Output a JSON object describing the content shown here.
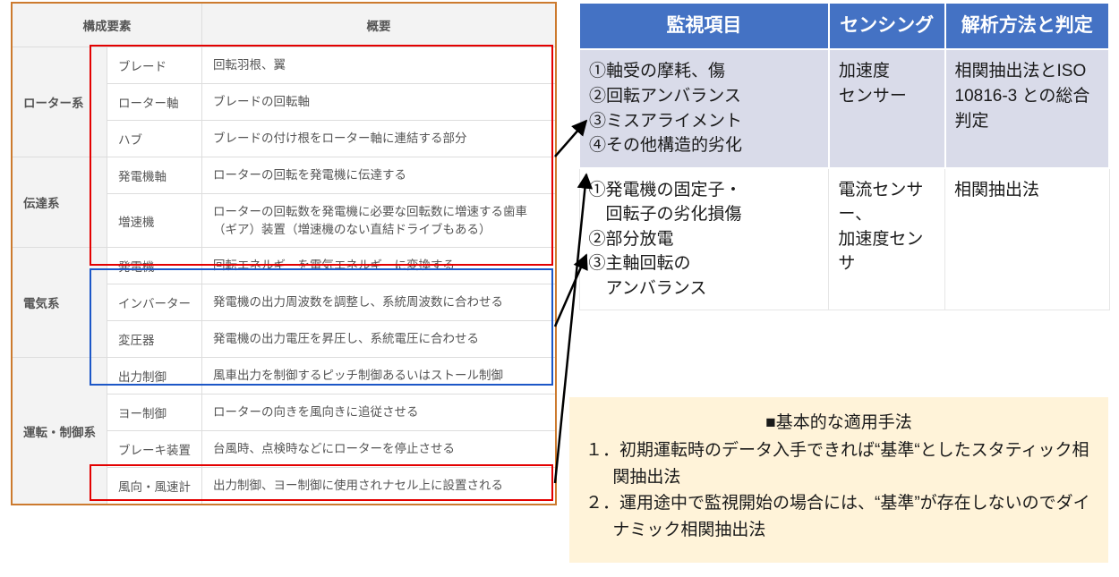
{
  "left": {
    "headers": {
      "component": "構成要素",
      "overview": "概要"
    },
    "groups": [
      {
        "name": "ローター系",
        "rows": [
          {
            "comp": "ブレード",
            "desc": "回転羽根、翼"
          },
          {
            "comp": "ローター軸",
            "desc": "ブレードの回転軸"
          },
          {
            "comp": "ハブ",
            "desc": "ブレードの付け根をローター軸に連結する部分"
          }
        ]
      },
      {
        "name": "伝達系",
        "rows": [
          {
            "comp": "発電機軸",
            "desc": "ローターの回転を発電機に伝達する"
          },
          {
            "comp": "増速機",
            "desc": "ローターの回転数を発電機に必要な回転数に増速する歯車（ギア）装置（増速機のない直結ドライブもある）"
          }
        ]
      },
      {
        "name": "電気系",
        "rows": [
          {
            "comp": "発電機",
            "desc": "回転エネルギーを電気エネルギーに変換する"
          },
          {
            "comp": "インバーター",
            "desc": "発電機の出力周波数を調整し、系統周波数に合わせる"
          },
          {
            "comp": "変圧器",
            "desc": "発電機の出力電圧を昇圧し、系統電圧に合わせる"
          }
        ]
      },
      {
        "name": "運転・制御系",
        "rows": [
          {
            "comp": "出力制御",
            "desc": "風車出力を制御するピッチ制御あるいはストール制御"
          },
          {
            "comp": "ヨー制御",
            "desc": "ローターの向きを風向きに追従させる"
          },
          {
            "comp": "ブレーキ装置",
            "desc": "台風時、点検時などにローターを停止させる"
          },
          {
            "comp": "風向・風速計",
            "desc": "出力制御、ヨー制御に使用されナセル上に設置される"
          }
        ]
      }
    ]
  },
  "right": {
    "headers": {
      "monitor": "監視項目",
      "sensing": "センシング",
      "analysis": "解析方法と判定"
    },
    "rows": [
      {
        "monitor": "①軸受の摩耗、傷\n②回転アンバランス\n③ミスアライメント\n④その他構造的劣化",
        "sensing": "加速度\nセンサー",
        "analysis": "相関抽出法とISO 10816-3 との総合判定"
      },
      {
        "monitor": "①発電機の固定子・\n　回転子の劣化損傷\n②部分放電\n③主軸回転の\n　アンバランス",
        "sensing": "電流センサー、\n加速度センサ",
        "analysis": "相関抽出法"
      }
    ]
  },
  "note": {
    "title": "■基本的な適用手法",
    "item1": "１．初期運転時のデータ入手できれば“基準“としたスタティック相関抽出法",
    "item2": "２．運用途中で監視開始の場合には、“基準”が存在しないのでダイナミック相関抽出法"
  }
}
